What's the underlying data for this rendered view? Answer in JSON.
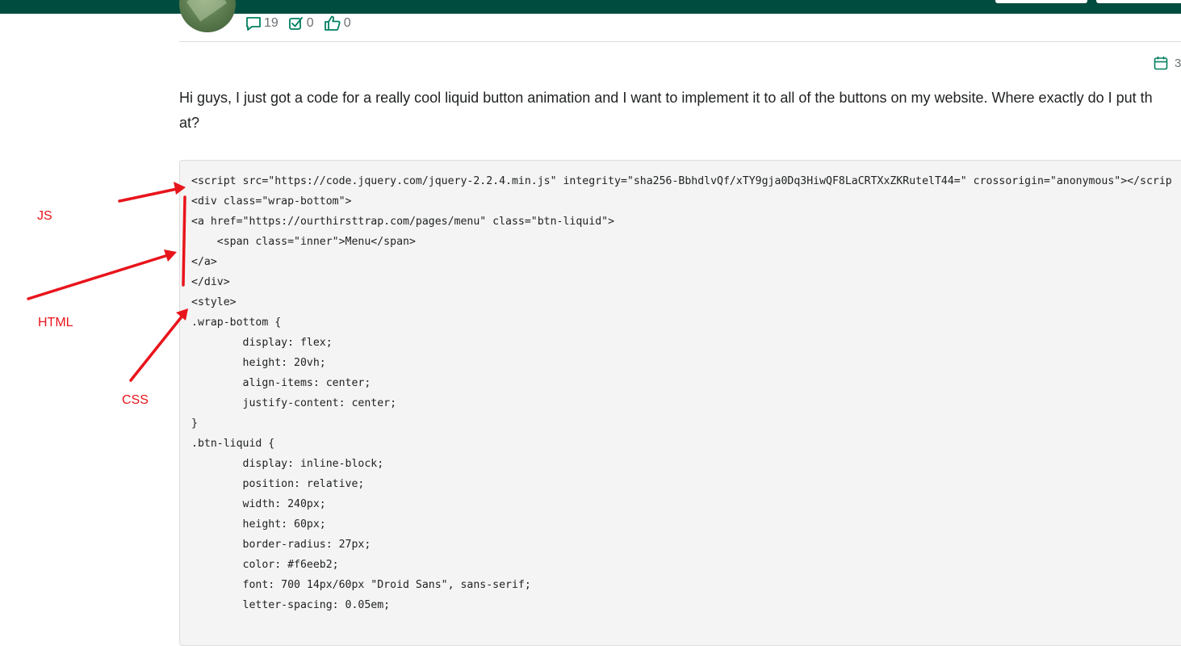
{
  "header": {
    "stats": {
      "comments": "19",
      "solutions": "0",
      "likes": "0"
    },
    "date": "3"
  },
  "post": {
    "line1": "Hi guys, I just got a code for a really cool liquid button animation and I want to implement it to all of the buttons on my website. Where exactly do I put th",
    "line2": "at?"
  },
  "code": {
    "lines": [
      "<script src=\"https://code.jquery.com/jquery-2.2.4.min.js\" integrity=\"sha256-BbhdlvQf/xTY9gja0Dq3HiwQF8LaCRTXxZKRutelT44=\" crossorigin=\"anonymous\"></scrip",
      "<div class=\"wrap-bottom\">",
      "<a href=\"https://ourthirsttrap.com/pages/menu\" class=\"btn-liquid\">",
      "    <span class=\"inner\">Menu</span>",
      "</a>",
      "</div>",
      "<style>",
      ".wrap-bottom {",
      "        display: flex;",
      "        height: 20vh;",
      "        align-items: center;",
      "        justify-content: center;",
      "}",
      ".btn-liquid {",
      "        display: inline-block;",
      "        position: relative;",
      "        width: 240px;",
      "        height: 60px;",
      "        border-radius: 27px;",
      "        color: #f6eeb2;",
      "        font: 700 14px/60px \"Droid Sans\", sans-serif;",
      "        letter-spacing: 0.05em;",
      ""
    ]
  },
  "annotations": {
    "js": "JS",
    "html": "HTML",
    "css": "CSS"
  },
  "colors": {
    "topbar": "#004c3f",
    "annotation": "#e8141b",
    "code_bg": "#f4f4f4",
    "icon": "#008060"
  }
}
